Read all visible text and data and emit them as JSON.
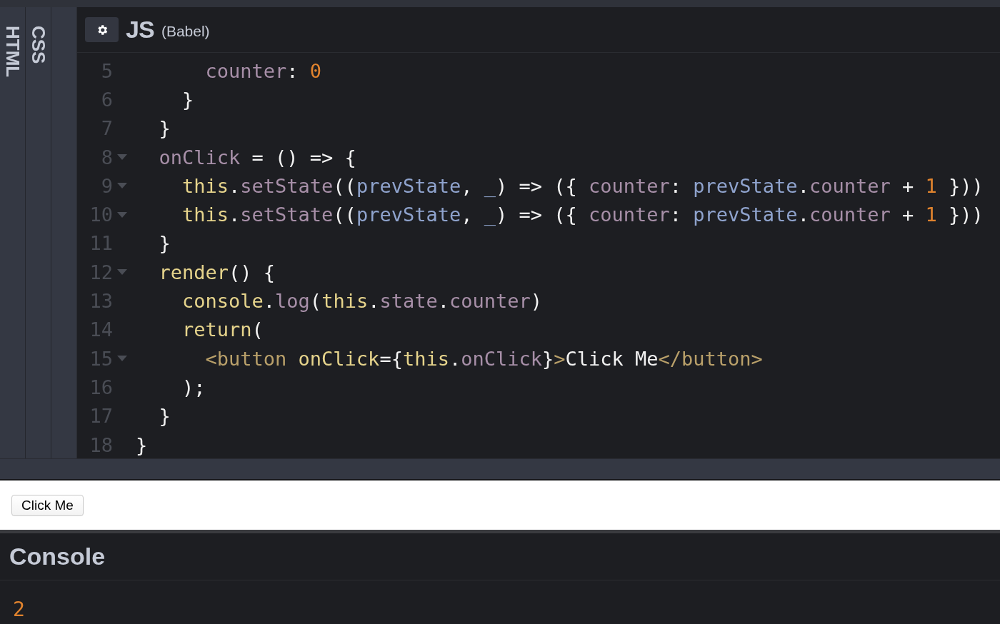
{
  "side_tabs": [
    {
      "label": "HTML"
    },
    {
      "label": "CSS"
    }
  ],
  "editor": {
    "title": "JS",
    "subtitle": "(Babel)",
    "lines": [
      {
        "number": "5",
        "foldable": false,
        "tokens": [
          {
            "kind": "prop",
            "text": "      counter"
          },
          {
            "kind": "plain",
            "text": ": "
          },
          {
            "kind": "num",
            "text": "0"
          }
        ]
      },
      {
        "number": "6",
        "foldable": false,
        "tokens": [
          {
            "kind": "plain",
            "text": "    }"
          }
        ]
      },
      {
        "number": "7",
        "foldable": false,
        "tokens": [
          {
            "kind": "plain",
            "text": "  }"
          }
        ]
      },
      {
        "number": "8",
        "foldable": true,
        "tokens": [
          {
            "kind": "prop",
            "text": "  onClick"
          },
          {
            "kind": "plain",
            "text": " = () => {"
          }
        ]
      },
      {
        "number": "9",
        "foldable": true,
        "tokens": [
          {
            "kind": "kw",
            "text": "    this"
          },
          {
            "kind": "plain",
            "text": "."
          },
          {
            "kind": "prop",
            "text": "setState"
          },
          {
            "kind": "plain",
            "text": "(("
          },
          {
            "kind": "param",
            "text": "prevState"
          },
          {
            "kind": "plain",
            "text": ", "
          },
          {
            "kind": "param",
            "text": "_"
          },
          {
            "kind": "plain",
            "text": ") => ({ "
          },
          {
            "kind": "prop",
            "text": "counter"
          },
          {
            "kind": "plain",
            "text": ": "
          },
          {
            "kind": "param",
            "text": "prevState"
          },
          {
            "kind": "plain",
            "text": "."
          },
          {
            "kind": "prop",
            "text": "counter"
          },
          {
            "kind": "plain",
            "text": " + "
          },
          {
            "kind": "num",
            "text": "1"
          },
          {
            "kind": "plain",
            "text": " }))"
          }
        ]
      },
      {
        "number": "10",
        "foldable": true,
        "tokens": [
          {
            "kind": "kw",
            "text": "    this"
          },
          {
            "kind": "plain",
            "text": "."
          },
          {
            "kind": "prop",
            "text": "setState"
          },
          {
            "kind": "plain",
            "text": "(("
          },
          {
            "kind": "param",
            "text": "prevState"
          },
          {
            "kind": "plain",
            "text": ", "
          },
          {
            "kind": "param",
            "text": "_"
          },
          {
            "kind": "plain",
            "text": ") => ({ "
          },
          {
            "kind": "prop",
            "text": "counter"
          },
          {
            "kind": "plain",
            "text": ": "
          },
          {
            "kind": "param",
            "text": "prevState"
          },
          {
            "kind": "plain",
            "text": "."
          },
          {
            "kind": "prop",
            "text": "counter"
          },
          {
            "kind": "plain",
            "text": " + "
          },
          {
            "kind": "num",
            "text": "1"
          },
          {
            "kind": "plain",
            "text": " }))"
          }
        ]
      },
      {
        "number": "11",
        "foldable": false,
        "tokens": [
          {
            "kind": "plain",
            "text": "  }"
          }
        ]
      },
      {
        "number": "12",
        "foldable": true,
        "tokens": [
          {
            "kind": "kw",
            "text": "  render"
          },
          {
            "kind": "plain",
            "text": "() {"
          }
        ]
      },
      {
        "number": "13",
        "foldable": false,
        "tokens": [
          {
            "kind": "kw",
            "text": "    console"
          },
          {
            "kind": "plain",
            "text": "."
          },
          {
            "kind": "prop",
            "text": "log"
          },
          {
            "kind": "plain",
            "text": "("
          },
          {
            "kind": "kw",
            "text": "this"
          },
          {
            "kind": "plain",
            "text": "."
          },
          {
            "kind": "prop",
            "text": "state"
          },
          {
            "kind": "plain",
            "text": "."
          },
          {
            "kind": "prop",
            "text": "counter"
          },
          {
            "kind": "plain",
            "text": ")"
          }
        ]
      },
      {
        "number": "14",
        "foldable": false,
        "tokens": [
          {
            "kind": "kw",
            "text": "    return"
          },
          {
            "kind": "plain",
            "text": "("
          }
        ]
      },
      {
        "number": "15",
        "foldable": true,
        "tokens": [
          {
            "kind": "tag",
            "text": "      <button"
          },
          {
            "kind": "kw",
            "text": " onClick"
          },
          {
            "kind": "plain",
            "text": "={"
          },
          {
            "kind": "kw",
            "text": "this"
          },
          {
            "kind": "plain",
            "text": "."
          },
          {
            "kind": "prop",
            "text": "onClick"
          },
          {
            "kind": "plain",
            "text": "}"
          },
          {
            "kind": "tag",
            "text": ">"
          },
          {
            "kind": "plain",
            "text": "Click Me"
          },
          {
            "kind": "tag",
            "text": "</button>"
          }
        ]
      },
      {
        "number": "16",
        "foldable": false,
        "tokens": [
          {
            "kind": "plain",
            "text": "    );"
          }
        ]
      },
      {
        "number": "17",
        "foldable": false,
        "tokens": [
          {
            "kind": "plain",
            "text": "  }"
          }
        ]
      },
      {
        "number": "18",
        "foldable": false,
        "tokens": [
          {
            "kind": "plain",
            "text": "}"
          }
        ]
      }
    ]
  },
  "preview": {
    "button": "Click Me"
  },
  "console": {
    "title": "Console",
    "lines": [
      {
        "kind": "num",
        "text": "2"
      }
    ]
  }
}
